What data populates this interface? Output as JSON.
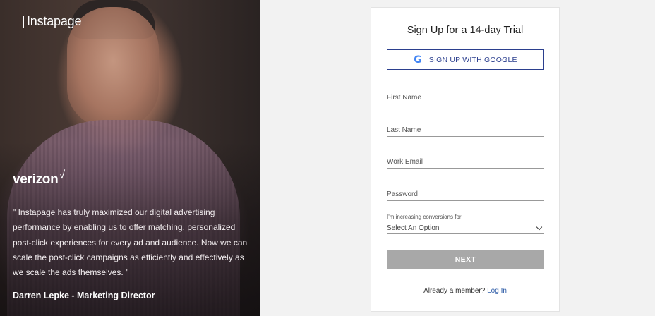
{
  "hero": {
    "brand": "Instapage",
    "customer_logo": "verizon",
    "customer_logo_mark": "√",
    "quote": "\" Instapage has truly maximized our digital advertising performance by enabling us to offer matching, personalized post-click experiences for every ad and audience. Now we can scale the post-click campaigns as efficiently and effectively as we scale the ads themselves. \"",
    "author": "Darren Lepke - Marketing Director"
  },
  "form": {
    "title": "Sign Up for a 14-day Trial",
    "google_icon": "G",
    "google_label": "SIGN UP WITH GOOGLE",
    "fields": {
      "first_name": "First Name",
      "last_name": "Last Name",
      "work_email": "Work Email",
      "password": "Password"
    },
    "select_label": "I'm increasing conversions for",
    "select_value": "Select An Option",
    "next_label": "NEXT",
    "member_text": "Already a member?",
    "login_label": "Log In"
  },
  "colors": {
    "accent": "#2b3f8e",
    "link": "#2b5aa6",
    "button_disabled": "#a8a8a8"
  }
}
